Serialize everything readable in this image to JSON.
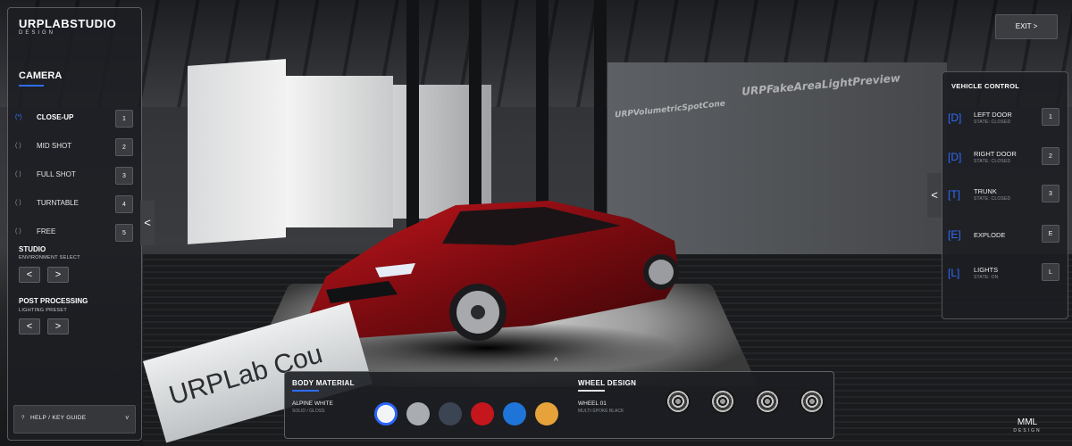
{
  "brand": {
    "name": "URPLABSTUDIO",
    "sub": "DESIGN"
  },
  "camera": {
    "title": "CAMERA",
    "options": [
      {
        "radio": "(*)",
        "label": "CLOSE-UP",
        "key": "1",
        "selected": true
      },
      {
        "radio": "( )",
        "label": "MID SHOT",
        "key": "2",
        "selected": false
      },
      {
        "radio": "( )",
        "label": "FULL SHOT",
        "key": "3",
        "selected": false
      },
      {
        "radio": "( )",
        "label": "TURNTABLE",
        "key": "4",
        "selected": false
      },
      {
        "radio": "( )",
        "label": "FREE",
        "key": "5",
        "selected": false
      }
    ]
  },
  "studio": {
    "title": "STUDIO",
    "sub": "ENVIRONMENT SELECT",
    "prev": "<",
    "next": ">"
  },
  "post": {
    "title": "POST PROCESSING",
    "sub": "LIGHTING PRESET",
    "prev": "<",
    "next": ">"
  },
  "help": {
    "icon": "?",
    "label": "HELP / KEY GUIDE",
    "chevron": "v"
  },
  "collapse_left": "<",
  "collapse_right": "<",
  "exit": {
    "label": "EXIT  >"
  },
  "vehicle": {
    "title": "VEHICLE CONTROL",
    "items": [
      {
        "tag": "[D]",
        "name": "LEFT DOOR",
        "state": "STATE: CLOSED",
        "key": "1"
      },
      {
        "tag": "[D]",
        "name": "RIGHT DOOR",
        "state": "STATE: CLOSED",
        "key": "2"
      },
      {
        "tag": "[T]",
        "name": "TRUNK",
        "state": "STATE: CLOSED",
        "key": "3"
      },
      {
        "tag": "[E]",
        "name": "EXPLODE",
        "state": "",
        "key": "E"
      },
      {
        "tag": "[L]",
        "name": "LIGHTS",
        "state": "STATE: ON",
        "key": "L"
      }
    ]
  },
  "body_material": {
    "title": "BODY MATERIAL",
    "selected_name": "ALPINE WHITE",
    "selected_sub": "SOLID / GLOSS",
    "swatches": [
      "#f2f3f5",
      "#a9adb2",
      "#3b4452",
      "#c4161c",
      "#1f74d8",
      "#e6a33a"
    ],
    "selected_index": 0
  },
  "wheel_design": {
    "title": "WHEEL DESIGN",
    "selected_name": "WHEEL 01",
    "selected_sub": "MULTI-SPOKE BLACK",
    "count": 4
  },
  "scroll_up": "^",
  "scene": {
    "label1": "URPVolumetricSpotCone",
    "label2": "URPFakeAreaLightPreview",
    "sign": "URPLab Cou"
  },
  "footer": {
    "logo": "MML",
    "sub": "DESIGN"
  },
  "colors": {
    "accent": "#2f6cff",
    "panel": "#1c1e22"
  }
}
